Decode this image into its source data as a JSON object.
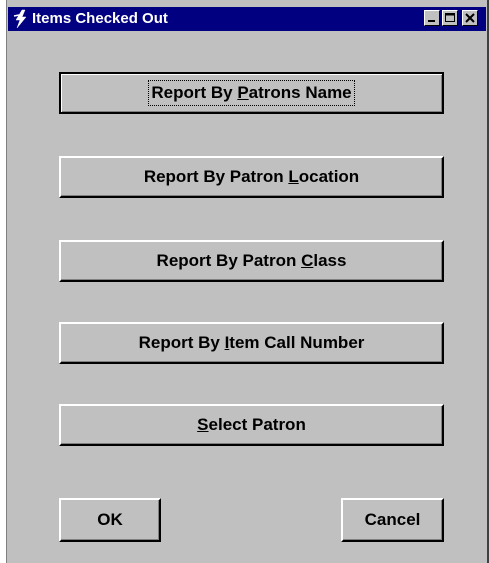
{
  "window": {
    "title": "Items Checked Out",
    "icon": "lightning-app-icon",
    "controls": {
      "minimize": "minimize-icon",
      "maximize": "maximize-icon",
      "close": "close-icon"
    }
  },
  "buttons": {
    "by_name": {
      "pre": "Report By ",
      "key": "P",
      "post": "atrons Name"
    },
    "by_location": {
      "pre": "Report By Patron ",
      "key": "L",
      "post": "ocation"
    },
    "by_class": {
      "pre": "Report By Patron ",
      "key": "C",
      "post": "lass"
    },
    "by_call_number": {
      "pre": "Report By ",
      "key": "I",
      "post": "tem Call Number"
    },
    "select_patron": {
      "pre": "",
      "key": "S",
      "post": "elect Patron"
    },
    "ok": "OK",
    "cancel": "Cancel"
  }
}
